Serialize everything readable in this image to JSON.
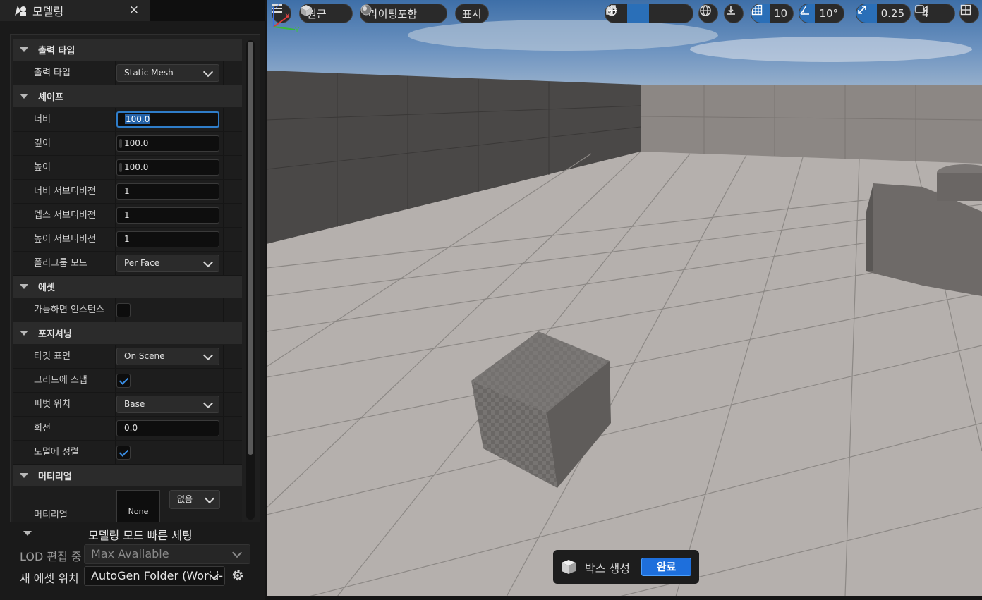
{
  "panel": {
    "tab_title": "모델링",
    "tab_close": "×",
    "categories": {
      "output": "출력 타입",
      "shape": "셰이프",
      "asset": "에셋",
      "positioning": "포지셔닝",
      "material": "머티리얼"
    },
    "rows": {
      "output_type": {
        "label": "출력 타입",
        "value": "Static Mesh"
      },
      "width": {
        "label": "너비",
        "value": "100.0"
      },
      "depth": {
        "label": "깊이",
        "value": "100.0"
      },
      "height": {
        "label": "높이",
        "value": "100.0"
      },
      "width_subdiv": {
        "label": "너비 서브디비전",
        "value": "1"
      },
      "depth_subdiv": {
        "label": "뎁스 서브디비전",
        "value": "1"
      },
      "height_subdiv": {
        "label": "높이 서브디비전",
        "value": "1"
      },
      "polygroup_mode": {
        "label": "폴리그룹 모드",
        "value": "Per Face"
      },
      "instance_if_possible": {
        "label": "가능하면 인스턴스",
        "checked": false
      },
      "target_surface": {
        "label": "타깃 표면",
        "value": "On Scene"
      },
      "snap_to_grid": {
        "label": "그리드에 스냅",
        "checked": true
      },
      "pivot_location": {
        "label": "피벗 위치",
        "value": "Base"
      },
      "rotation": {
        "label": "회전",
        "value": "0.0"
      },
      "align_to_normal": {
        "label": "노멀에 정렬",
        "checked": true
      },
      "material": {
        "label": "머티리얼",
        "thumb": "None",
        "value": "없음"
      }
    }
  },
  "quick_settings": {
    "title": "모델링 모드 빠른 세팅",
    "lod_label": "LOD 편집 중",
    "lod_value": "Max Available",
    "asset_location_label": "새 에셋 위치",
    "asset_location_value": "AutoGen Folder (World-Relative)"
  },
  "viewport": {
    "perspective_label": "원근",
    "lighting_label": "라이팅포함",
    "show_label": "표시",
    "grid_snap": "10",
    "rotation_snap": "10°",
    "scale_snap": "0.25",
    "camera_speed": "4",
    "status_label": "박스 생성",
    "done_label": "완료"
  },
  "colors": {
    "accent": "#2a6fb8",
    "done_button": "#1e6fdc",
    "checkmark": "#3a8fe6"
  }
}
